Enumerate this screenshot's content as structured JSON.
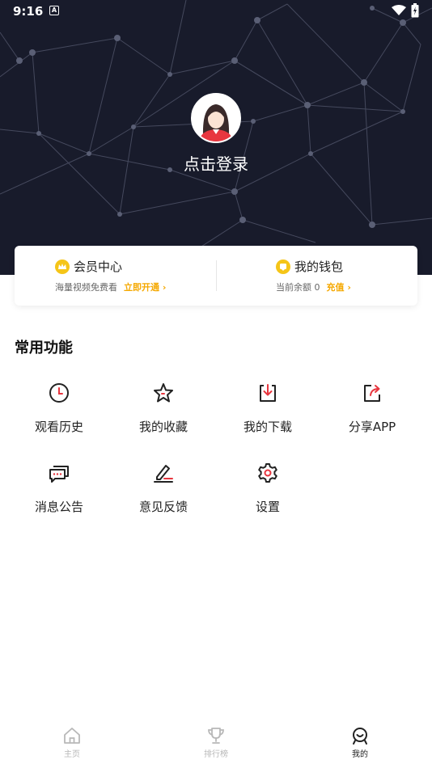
{
  "status_bar": {
    "time": "9:16",
    "notification_icon": "A"
  },
  "header": {
    "login_text": "点击登录"
  },
  "vip_card": {
    "member": {
      "title": "会员中心",
      "subtitle": "海量视频免费看",
      "action": "立即开通 ›"
    },
    "wallet": {
      "title": "我的钱包",
      "subtitle": "当前余额 0",
      "action": "充值 ›"
    }
  },
  "functions": {
    "title": "常用功能",
    "items": [
      {
        "label": "观看历史",
        "icon": "clock-icon"
      },
      {
        "label": "我的收藏",
        "icon": "star-icon"
      },
      {
        "label": "我的下载",
        "icon": "download-icon"
      },
      {
        "label": "分享APP",
        "icon": "share-icon"
      },
      {
        "label": "消息公告",
        "icon": "message-icon"
      },
      {
        "label": "意见反馈",
        "icon": "edit-icon"
      },
      {
        "label": "设置",
        "icon": "gear-icon"
      }
    ]
  },
  "bottom_nav": {
    "items": [
      {
        "label": "主页",
        "icon": "home-icon",
        "active": false
      },
      {
        "label": "排行榜",
        "icon": "trophy-icon",
        "active": false
      },
      {
        "label": "我的",
        "icon": "profile-icon",
        "active": true
      }
    ]
  },
  "colors": {
    "header_bg": "#181b2b",
    "accent": "#f5a800",
    "red": "#e8363f"
  }
}
